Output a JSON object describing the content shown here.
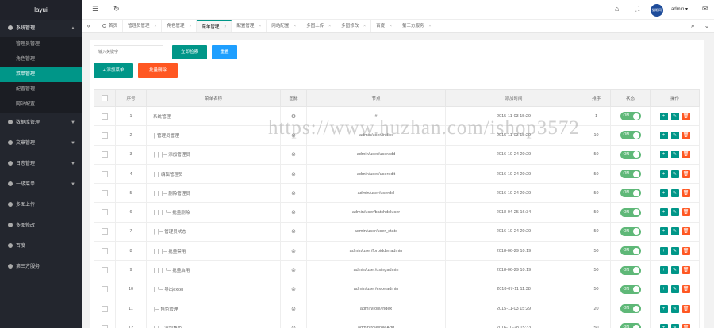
{
  "sidebar": {
    "logo": "layui",
    "group_open": {
      "label": "系统管理",
      "arrow": "▲"
    },
    "sub_items": [
      "管理员管理",
      "角色管理",
      "菜单管理",
      "配置管理",
      "网站配置"
    ],
    "active_sub": 2,
    "items": [
      {
        "label": "数据库管理",
        "arrow": "▼"
      },
      {
        "label": "文章管理",
        "arrow": "▼"
      },
      {
        "label": "日志管理",
        "arrow": "▼"
      },
      {
        "label": "一级菜单",
        "arrow": "▼"
      },
      {
        "label": "多图上传",
        "arrow": ""
      },
      {
        "label": "多图修改",
        "arrow": ""
      },
      {
        "label": "百度",
        "arrow": ""
      },
      {
        "label": "第三方服务",
        "arrow": ""
      }
    ]
  },
  "header": {
    "menu_icon": "☰",
    "refresh_icon": "↻",
    "tag_icon": "⌂",
    "fullscreen_icon": "⛶",
    "avatar_text": "猫眼网",
    "username": "admin ▾",
    "msg_icon": "✉"
  },
  "tabbar": {
    "prev": "«",
    "next": "»",
    "more": "⌄",
    "tabs": [
      {
        "label": "首页",
        "home": true,
        "closable": false
      },
      {
        "label": "管理员管理",
        "closable": true
      },
      {
        "label": "角色管理",
        "closable": true
      },
      {
        "label": "菜单管理",
        "closable": true,
        "active": true
      },
      {
        "label": "配置管理",
        "closable": true
      },
      {
        "label": "网站配置",
        "closable": true
      },
      {
        "label": "多图上传",
        "closable": true
      },
      {
        "label": "多图修改",
        "closable": true
      },
      {
        "label": "百度",
        "closable": true
      },
      {
        "label": "第三方服务",
        "closable": true
      }
    ],
    "close_glyph": "×"
  },
  "toolbar": {
    "search_placeholder": "输入关键字",
    "search_btn": "立即检索",
    "reset_btn": "重置",
    "add_btn": "+ 添加菜单",
    "batch_delete_btn": "批量删除"
  },
  "watermark": "https://www.huzhan.com/ishop3572",
  "table": {
    "headers": [
      "",
      "序号",
      "菜单名称",
      "图标",
      "节点",
      "添加时间",
      "排序",
      "状态",
      "操作"
    ],
    "switch_on": "ON",
    "rows": [
      {
        "id": "1",
        "name": "系统管理",
        "icon": "⚙",
        "node": "#",
        "time": "2015-11-03 15:29",
        "sort": "1"
      },
      {
        "id": "2",
        "name": "│ 管理员管理",
        "icon": "⊘",
        "node": "admin/user/index",
        "time": "2015-11-03 15:29",
        "sort": "10"
      },
      {
        "id": "3",
        "name": "│ │ ├─ 添加管理员",
        "icon": "⊘",
        "node": "admin/user/useradd",
        "time": "2016-10-24 20:29",
        "sort": "50"
      },
      {
        "id": "4",
        "name": "│ │ 编辑管理员",
        "icon": "⊘",
        "node": "admin/user/useredit",
        "time": "2016-10-24 20:29",
        "sort": "50"
      },
      {
        "id": "5",
        "name": "│ │ ├─ 删除管理员",
        "icon": "⊘",
        "node": "admin/user/userdel",
        "time": "2016-10-24 20:29",
        "sort": "50"
      },
      {
        "id": "6",
        "name": "│ │ │ └─ 批量删除",
        "icon": "⊘",
        "node": "admin/user/batchdeluser",
        "time": "2018-04-25 16:34",
        "sort": "50"
      },
      {
        "id": "7",
        "name": "│ ├─ 管理员状态",
        "icon": "⊘",
        "node": "admin/user/user_state",
        "time": "2016-10-24 20:29",
        "sort": "50"
      },
      {
        "id": "8",
        "name": "│ │ ├─ 批量禁用",
        "icon": "⊘",
        "node": "admin/user/forbiddenadmin",
        "time": "2018-06-29 10:19",
        "sort": "50"
      },
      {
        "id": "9",
        "name": "│ │ │ └─ 批量启用",
        "icon": "⊘",
        "node": "admin/user/usingadmin",
        "time": "2018-06-29 10:19",
        "sort": "50"
      },
      {
        "id": "10",
        "name": "│ └─ 导出excel",
        "icon": "⊘",
        "node": "admin/user/exceladmin",
        "time": "2018-07-11 11:38",
        "sort": "50"
      },
      {
        "id": "11",
        "name": "├─ 角色管理",
        "icon": "⊘",
        "node": "admin/role/index",
        "time": "2015-11-03 15:29",
        "sort": "20"
      },
      {
        "id": "12",
        "name": "│ ├─ 添加角色",
        "icon": "⊘",
        "node": "admin/role/roleAdd",
        "time": "2016-10-28 15:33",
        "sort": "50"
      }
    ],
    "actions": {
      "add": "+",
      "edit": "✎",
      "delete": "🗑"
    }
  },
  "colors": {
    "accent": "#009688",
    "blue": "#1e9fff",
    "danger": "#ff5722",
    "switch_on": "#5fb878",
    "sidebar_bg": "#23262e"
  }
}
